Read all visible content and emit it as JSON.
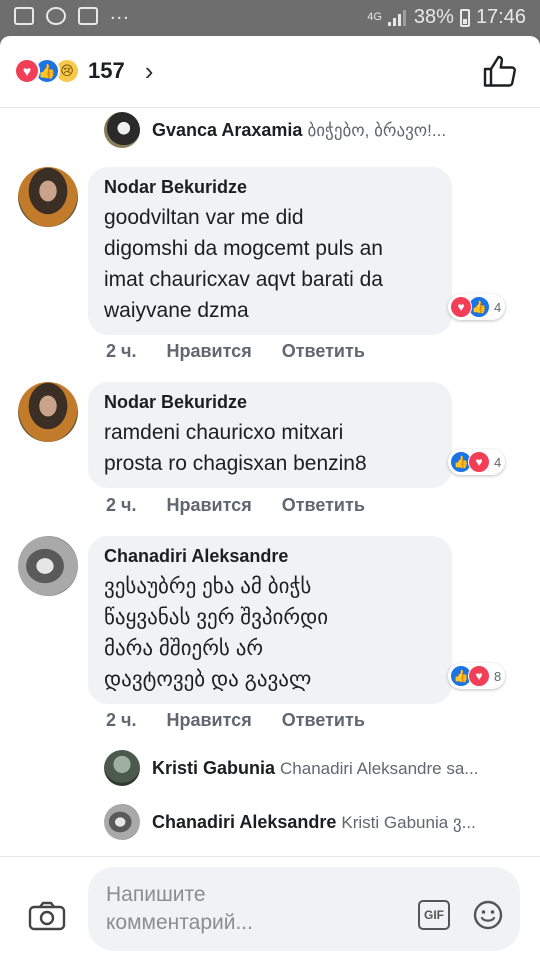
{
  "status_bar": {
    "network": "4G",
    "battery": "38%",
    "time": "17:46",
    "left_icons": [
      "gallery-icon",
      "messenger-icon",
      "facebook-icon"
    ],
    "overflow": "..."
  },
  "header": {
    "reactions": [
      "love",
      "like",
      "sad"
    ],
    "count": "157",
    "chevron": "›"
  },
  "comments": [
    {
      "type": "reply",
      "name": "Gvanca Araxamia",
      "text": "ბიჭებო, ბრავო!..."
    },
    {
      "type": "comment",
      "name": "Nodar Bekuridze",
      "lines": [
        "goodviltan var me did",
        "digomshi da mogcemt puls an",
        "imat chauricxav aqvt barati da",
        "waiyvane dzma"
      ],
      "reactions": [
        "love",
        "like"
      ],
      "reaction_count": "4",
      "time": "2 ч.",
      "like_label": "Нравится",
      "reply_label": "Ответить"
    },
    {
      "type": "comment",
      "name": "Nodar Bekuridze",
      "lines": [
        "ramdeni chauricxo mitxari",
        "prosta ro chagisxan benzin8"
      ],
      "reactions": [
        "like",
        "love"
      ],
      "reaction_count": "4",
      "time": "2 ч.",
      "like_label": "Нравится",
      "reply_label": "Ответить"
    },
    {
      "type": "comment",
      "name": "Chanadiri Aleksandre",
      "lines": [
        "ვესაუბრე ეხა ამ ბიჭს",
        "წაყვანას ვერ შვპირდი",
        "მარა მშიერს არ",
        "დავტოვებ და გავალ"
      ],
      "reactions": [
        "like",
        "love"
      ],
      "reaction_count": "8",
      "time": "2 ч.",
      "like_label": "Нравится",
      "reply_label": "Ответить"
    },
    {
      "type": "reply",
      "name": "Kristi Gabunia",
      "text": "Chanadiri Aleksandre sa..."
    },
    {
      "type": "reply",
      "name": "Chanadiri Aleksandre",
      "text": "Kristi Gabunia ვ..."
    }
  ],
  "composer": {
    "placeholder": "Напишите комментарий...",
    "gif_label": "GIF"
  },
  "colors": {
    "love": "#f33e58",
    "like": "#1b74e4",
    "sad": "#f7c94b",
    "bubble": "#f0f2f5",
    "meta_text": "#606770"
  }
}
